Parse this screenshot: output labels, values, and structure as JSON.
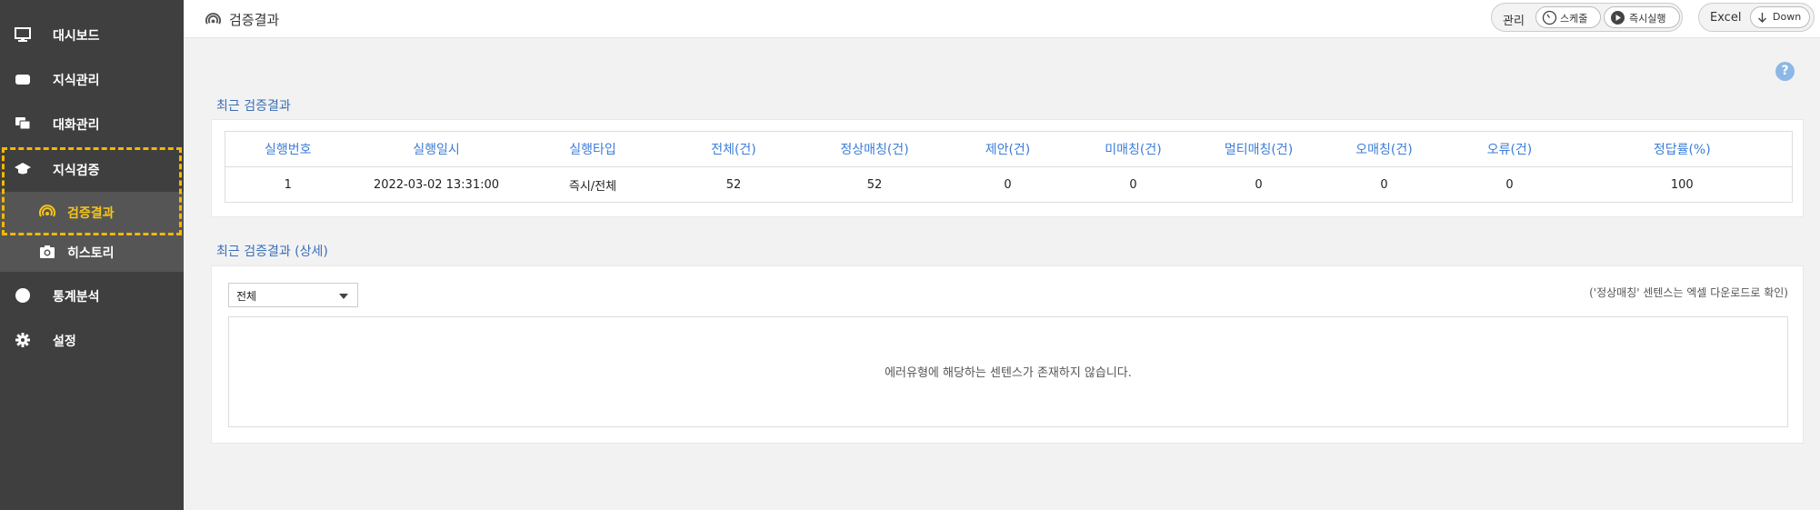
{
  "sidebar": {
    "items": [
      {
        "label": "대시보드",
        "icon": "monitor-icon"
      },
      {
        "label": "지식관리",
        "icon": "folder-icon"
      },
      {
        "label": "대화관리",
        "icon": "chat-icon"
      },
      {
        "label": "지식검증",
        "icon": "graduation-cap-icon"
      }
    ],
    "subitems": [
      {
        "label": "검증결과",
        "icon": "signal-icon",
        "active": true
      },
      {
        "label": "히스토리",
        "icon": "camera-icon",
        "active": false
      }
    ],
    "bottom_items": [
      {
        "label": "통계분석",
        "icon": "pie-chart-icon"
      },
      {
        "label": "설정",
        "icon": "gear-icon"
      }
    ],
    "accent_color": "#f5c518"
  },
  "header": {
    "title": "검증결과",
    "manage_label": "관리",
    "schedule_label": "스케줄",
    "run_now_label": "즉시실행",
    "excel_label": "Excel",
    "down_label": "Down"
  },
  "summary": {
    "title": "최근 검증결과",
    "columns": [
      "실행번호",
      "실행일시",
      "실행타입",
      "전체(건)",
      "정상매칭(건)",
      "제안(건)",
      "미매칭(건)",
      "멀티매칭(건)",
      "오매칭(건)",
      "오류(건)",
      "정답률(%)"
    ],
    "row": [
      "1",
      "2022-03-02 13:31:00",
      "즉시/전체",
      "52",
      "52",
      "0",
      "0",
      "0",
      "0",
      "0",
      "100"
    ]
  },
  "detail": {
    "title": "최근 검증결과 (상세)",
    "filter_value": "전체",
    "note": "('정상매칭' 센텐스는 엑셀 다운로드로 확인)",
    "empty_message": "에러유형에 해당하는 센텐스가 존재하지 않습니다."
  },
  "help_label": "?"
}
